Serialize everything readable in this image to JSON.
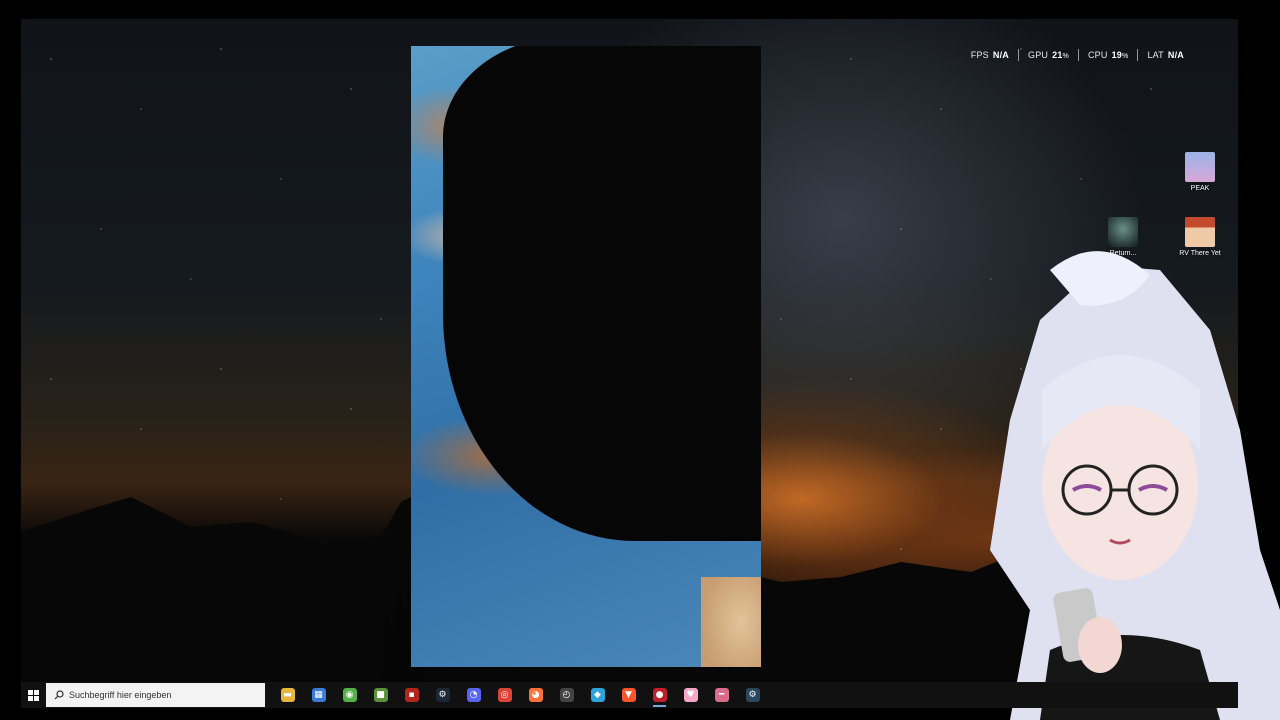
{
  "overlay": {
    "fps_label": "FPS",
    "fps_value": "N/A",
    "gpu_label": "GPU",
    "gpu_value": "21",
    "cpu_label": "CPU",
    "cpu_value": "19",
    "lat_label": "LAT",
    "lat_value": "N/A",
    "percent_symbol": "%"
  },
  "desktop_icons": [
    {
      "label": "PEAK",
      "icon": "peak-game-icon"
    },
    {
      "label": "Return...",
      "icon": "return-game-icon"
    },
    {
      "label": "RV There Yet",
      "icon": "rv-there-yet-game-icon"
    }
  ],
  "taskbar": {
    "search_placeholder": "Suchbegriff hier eingeben",
    "apps": [
      {
        "name": "file-explorer-icon",
        "color": "#e8b63a",
        "glyph": "▬"
      },
      {
        "name": "store-icon",
        "color": "#3a7bd5",
        "glyph": "▦"
      },
      {
        "name": "android-app-icon",
        "color": "#56b04a",
        "glyph": "◉"
      },
      {
        "name": "minecraft-icon",
        "color": "#5c8f3a",
        "glyph": "■"
      },
      {
        "name": "mixed-reality-icon",
        "color": "#b3261e",
        "glyph": "▪"
      },
      {
        "name": "steam-icon",
        "color": "#1b2838",
        "glyph": "⚙"
      },
      {
        "name": "discord-icon",
        "color": "#5865f2",
        "glyph": "◔"
      },
      {
        "name": "chrome-icon",
        "color": "#db4437",
        "glyph": "◎"
      },
      {
        "name": "firefox-icon",
        "color": "#ff7139",
        "glyph": "◕"
      },
      {
        "name": "speedometer-icon",
        "color": "#444444",
        "glyph": "◴"
      },
      {
        "name": "streamer-bot-icon",
        "color": "#2fa3d9",
        "glyph": "◆"
      },
      {
        "name": "brave-icon",
        "color": "#fb542b",
        "glyph": "▼"
      },
      {
        "name": "record-icon",
        "color": "#c0202a",
        "glyph": "●"
      },
      {
        "name": "pink-app-icon",
        "color": "#f3a6c8",
        "glyph": "♥"
      },
      {
        "name": "slider-app-icon",
        "color": "#d86a8a",
        "glyph": "━"
      },
      {
        "name": "steam-alt-icon",
        "color": "#2a475e",
        "glyph": "⚙"
      }
    ]
  }
}
